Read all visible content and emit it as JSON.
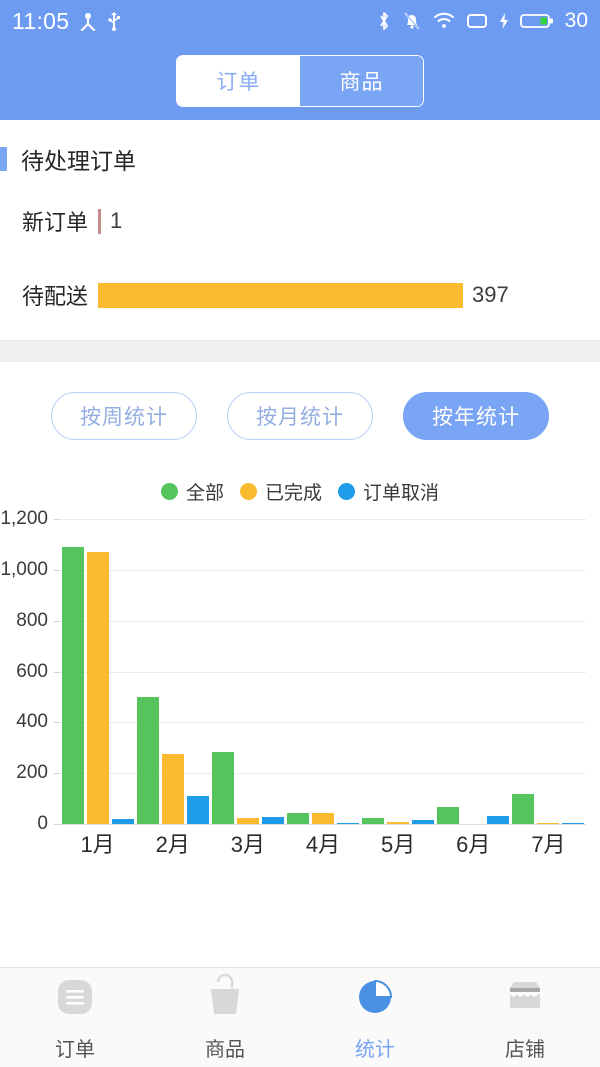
{
  "status_bar": {
    "time": "11:05",
    "battery_percent": "30",
    "icons": [
      "person-icon",
      "usb-icon",
      "bluetooth-icon",
      "bell-muted-icon",
      "wifi-icon",
      "sim-card-icon",
      "charging-bolt-icon",
      "battery-icon"
    ]
  },
  "header": {
    "segments": [
      {
        "label": "订单",
        "active": true
      },
      {
        "label": "商品",
        "active": false
      }
    ]
  },
  "pending": {
    "section_title": "待处理订单",
    "rows": [
      {
        "label": "新订单",
        "value": "1",
        "bar_color": "#c58c8c",
        "bar_kind": "tiny"
      },
      {
        "label": "待配送",
        "value": "397",
        "bar_color": "#fbbb2e",
        "bar_kind": "wide"
      }
    ]
  },
  "stats": {
    "filters": [
      {
        "label": "按周统计",
        "active": false
      },
      {
        "label": "按月统计",
        "active": false
      },
      {
        "label": "按年统计",
        "active": true
      }
    ]
  },
  "chart_data": {
    "type": "bar",
    "title": "",
    "xlabel": "",
    "ylabel": "",
    "ylim": [
      0,
      1200
    ],
    "yticks": [
      "0",
      "200",
      "400",
      "600",
      "800",
      "1,000",
      "1,200"
    ],
    "grid": true,
    "legend_position": "top-center",
    "categories": [
      "1月",
      "2月",
      "3月",
      "4月",
      "5月",
      "6月",
      "7月"
    ],
    "series": [
      {
        "name": "全部",
        "color": "#56c45d",
        "values": [
          1090,
          500,
          285,
          45,
          25,
          65,
          118
        ]
      },
      {
        "name": "已完成",
        "color": "#fbbb2e",
        "values": [
          1070,
          275,
          22,
          42,
          8,
          0,
          3
        ]
      },
      {
        "name": "订单取消",
        "color": "#1e9ce8",
        "values": [
          20,
          110,
          28,
          5,
          17,
          30,
          5
        ]
      }
    ]
  },
  "tabbar": {
    "items": [
      {
        "label": "订单",
        "icon": "list-icon",
        "active": false
      },
      {
        "label": "商品",
        "icon": "shopping-bag-icon",
        "active": false
      },
      {
        "label": "统计",
        "icon": "pie-chart-icon",
        "active": true
      },
      {
        "label": "店铺",
        "icon": "store-icon",
        "active": false
      }
    ]
  },
  "colors": {
    "brand_blue": "#6e9bf2",
    "accent_blue": "#7aa4f4",
    "green": "#56c45d",
    "orange": "#fbbb2e",
    "blue": "#1e9ce8"
  }
}
